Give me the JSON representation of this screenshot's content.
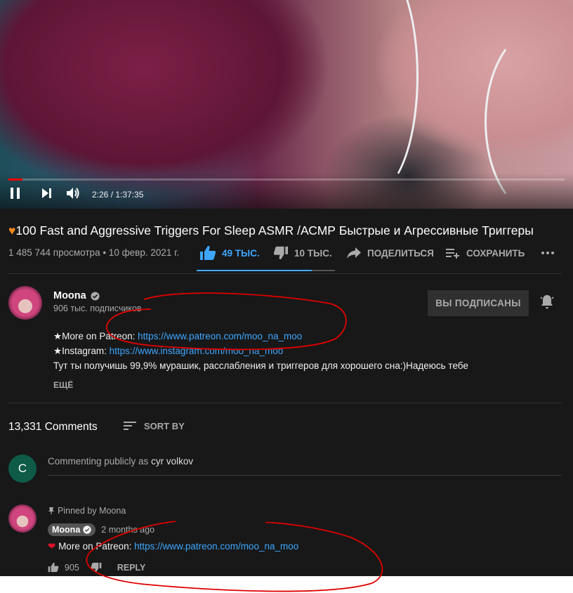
{
  "player": {
    "time_text": "2:26 / 1:37:35",
    "progress": 0.025
  },
  "video": {
    "title_icon": "orange-heart-icon",
    "title": "100 Fast and Aggressive Triggers For Sleep ASMR /АСМР Быстрые и Агрессивные Триггеры",
    "meta": "1 485 744 просмотра • 10 февр. 2021 г.",
    "like_count": "49 ТЫС.",
    "dislike_count": "10 ТЫС.",
    "like_ratio": 0.83,
    "share_label": "ПОДЕЛИТЬСЯ",
    "save_label": "СОХРАНИТЬ"
  },
  "channel": {
    "name": "Moona",
    "subscribers": "906 тыс. подписчиков",
    "subscribe_label": "ВЫ ПОДПИСАНЫ"
  },
  "description": {
    "line1_prefix": "★More on Patreon: ",
    "line1_link": "https://www.patreon.com/moo_na_moo",
    "line2_prefix": "★Instagram: ",
    "line2_link": "https://www.instagram.com/moo_na_moo",
    "line3": "Тут ты получишь 99,9% мурашик, расслабления и триггеров для хорошего сна:)Надеюсь тебе",
    "more_label": "ЕЩЁ"
  },
  "comments": {
    "count_text": "13,331 Comments",
    "sort_label": "SORT BY",
    "commenter_initial": "C",
    "input_prefix": "Commenting publicly as ",
    "input_user": "cyr volkov",
    "pinned": {
      "pinned_label": "Pinned by Moona",
      "author": "Moona",
      "time": "2 months ago",
      "text_prefix": " More on Patreon: ",
      "text_link": "https://www.patreon.com/moo_na_moo",
      "likes": "905",
      "reply_label": "REPLY"
    }
  },
  "colors": {
    "background": "#181818",
    "link": "#3ea6ff",
    "progress": "#ff0000",
    "annotation": "#e00000"
  }
}
